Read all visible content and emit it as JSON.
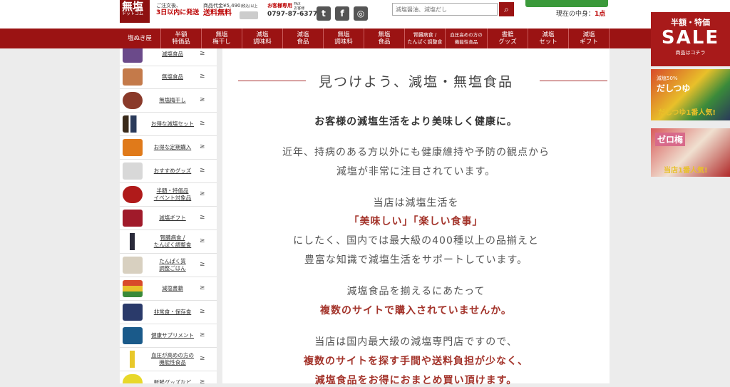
{
  "header": {
    "logo_main": "無塩",
    "logo_sub": "ドットコム",
    "ship_line1": "ご注文後、",
    "ship_line2": "3日以内に発送",
    "free_line1": "商品代金¥5,490",
    "free_line1b": "(税込)以上",
    "free_line2": "送料無料",
    "tel_label": "お客様専用",
    "tel_fax": "FAX\nお客様",
    "tel_number": "0797-87-6377",
    "sns": [
      "twitter-icon",
      "facebook-icon",
      "instagram-icon"
    ],
    "search_placeholder": "減塩醤油、減塩だし",
    "cart_label": "現在の中身：",
    "cart_value": "1点"
  },
  "nav": [
    {
      "label": "塩ぬき屋"
    },
    {
      "label": "半額\n特価品"
    },
    {
      "label": "無塩\n梅干し"
    },
    {
      "label": "減塩\n調味料"
    },
    {
      "label": "減塩\n食品"
    },
    {
      "label": "無塩\n調味料"
    },
    {
      "label": "無塩\n食品"
    },
    {
      "label": "腎臓病食 /\nたんぱく調整食"
    },
    {
      "label": "血圧高めの方の\n機能性食品"
    },
    {
      "label": "書籍\nグッズ"
    },
    {
      "label": "減塩\nセット"
    },
    {
      "label": "減塩\nギフト"
    }
  ],
  "sidebar": {
    "items": [
      {
        "label": "減塩食品",
        "icon": "box-icon"
      },
      {
        "label": "無塩食品",
        "icon": "food-icon"
      },
      {
        "label": "無塩梅干し",
        "icon": "umeboshi-icon"
      },
      {
        "label": "お得な減塩セット",
        "icon": "bottles-icon"
      },
      {
        "label": "お得な定期購入",
        "icon": "truck-icon"
      },
      {
        "label": "おすすめグッズ",
        "icon": "spoon-icon"
      },
      {
        "label": "半額・特価品\nイベント対象品",
        "icon": "discount-icon"
      },
      {
        "label": "減塩ギフト",
        "icon": "gift-icon"
      },
      {
        "label": "腎臓病食 /\nたんぱく調整食",
        "icon": "bottle-icon"
      },
      {
        "label": "たんぱく質\n調整ごはん",
        "icon": "rice-icon"
      },
      {
        "label": "減塩書籍",
        "icon": "books-icon"
      },
      {
        "label": "非常食・保存食",
        "icon": "can-icon"
      },
      {
        "label": "健康サプリメント",
        "icon": "supplement-icon"
      },
      {
        "label": "血圧が高めの方の\n機能性食品",
        "icon": "drink-icon"
      },
      {
        "label": "新鮮グッズなど",
        "icon": "cup-icon"
      }
    ],
    "arrow": "≥"
  },
  "main": {
    "heading": "見つけよう、減塩・無塩食品",
    "lead": "お客様の減塩生活をより美味しく健康に。",
    "p1_line1": "近年、持病のある方以外にも健康維持や予防の観点から",
    "p1_line2": "減塩が非常に注目されています。",
    "p2_line1": "当店は減塩生活を",
    "p2_line2": "「美味しい」「楽しい食事」",
    "p2_line3": "にしたく、国内では最大級の400種以上の品揃えと",
    "p2_line4": "豊富な知識で減塩生活をサポートしています。",
    "p3_line1": "減塩食品を揃えるにあたって",
    "p3_line2": "複数のサイトで購入されていませんか。",
    "p4_line1": "当店は国内最大級の減塩専門店ですので、",
    "p4_line2": "複数のサイトを探す手間や送料負担が少なく、",
    "p4_line3": "減塩食品をお得におまとめ買い頂けます。"
  },
  "right": {
    "sale_top": "半額・特価",
    "sale_big": "SALE",
    "sale_small": "商品はコチラ",
    "banner1_tag": "減塩50%",
    "banner1_title": "だしつゆ",
    "banner1_caption": "だしつゆ1番人気!",
    "banner2_title": "ゼロ梅",
    "banner2_caption": "当店1番人気!"
  }
}
